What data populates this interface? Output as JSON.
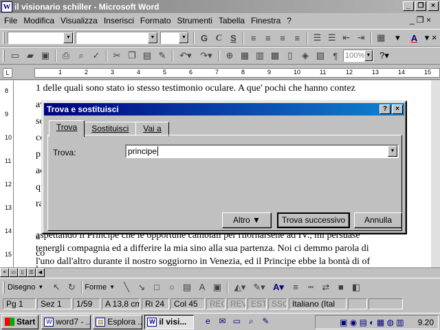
{
  "window": {
    "title": "il visionario schiller - Microsoft Word"
  },
  "menu": [
    "File",
    "Modifica",
    "Visualizza",
    "Inserisci",
    "Formato",
    "Strumenti",
    "Tabella",
    "Finestra",
    "?"
  ],
  "toolbar": {
    "style": "",
    "font": "",
    "size": "",
    "zoom": "100%"
  },
  "ruler": {
    "marks": [
      "1",
      "2",
      "3",
      "4",
      "5",
      "6",
      "7",
      "8",
      "9",
      "10",
      "11",
      "12",
      "13",
      "14",
      "15"
    ]
  },
  "vruler": {
    "marks": [
      "8",
      "9",
      "10",
      "11",
      "12",
      "13",
      "14",
      "15"
    ]
  },
  "document": {
    "lines": [
      "1 delle quali sono stato io stesso testimonio oculare. A que' pochi che hanno contez",
      "avvenimento politico, scriverenno questi fogli, se pur vedranno la luce durante la loro vita,",
      "sc",
      "co",
      "pi",
      "ac",
      "qu",
      "ra",
      "",
      "a",
      "co",
      "la",
      "aspettando il Principe che le opportune cambiali per rilornarsene ad IV., mi persuase",
      "tenergli compagnia ed a differire la mia sino alla sua partenza. Noi ci demmo parola di",
      "l'uno dall'altro durante il nostro soggiorno in Venezia, ed il Principe ebbe la bontà di of"
    ]
  },
  "drawing": {
    "disegno": "Disegno",
    "forme": "Forme"
  },
  "status": {
    "page": "Pg 1",
    "section": "Sez 1",
    "pages": "1/59",
    "at": "A 13,8 cm",
    "ri": "Ri 24",
    "col": "Col 45",
    "reg": "REG",
    "rev": "REV",
    "est": "EST",
    "ssc": "SSC",
    "lang": "Italiano (Ital"
  },
  "dialog": {
    "title": "Trova e sostituisci",
    "tabs": [
      "Trova",
      "Sostituisci",
      "Vai a"
    ],
    "find_label": "Trova:",
    "find_value": "principe",
    "buttons": {
      "more": "Altro ▼",
      "find_next": "Trova successivo",
      "cancel": "Annulla"
    }
  },
  "taskbar": {
    "start": "Start",
    "tasks": [
      "word7 - ...",
      "Esplora ...",
      "il visi..."
    ],
    "clock": "9.20"
  }
}
